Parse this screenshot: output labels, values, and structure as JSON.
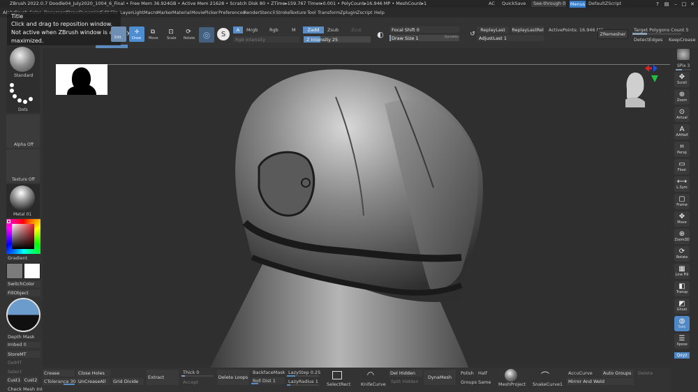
{
  "titlebar": {
    "title": "ZBrush 2022.0.7   Doodle04_July2020_1004_6_Final  • Free Mem 36.924GB • Active Mem 21628 • Scratch Disk 80 • ZTime▸159.767 Timer▸0.001 • PolyCount▸16.946 MP • MeshCount▸1",
    "ac": "AC",
    "quicksave": "QuickSave",
    "see_through": "See-through  0",
    "menus": "Menus",
    "script": "DefaultZScript"
  },
  "menubar": [
    "Alpha",
    "Brush",
    "Color",
    "Document",
    "Draw",
    "Dynamics",
    "Edit",
    "File",
    "Layer",
    "Light",
    "Macro",
    "Marker",
    "Material",
    "Movie",
    "Picker",
    "Preferences",
    "Render",
    "Stencil",
    "Stroke",
    "Texture",
    "Tool",
    "Transform",
    "Zplugin",
    "Zscript",
    "Help"
  ],
  "tooltip": {
    "title": "Title",
    "line1": "Click and drag to reposition window.",
    "line2": "Not active when ZBrush window is already",
    "line3": "maximized."
  },
  "toolbar": {
    "edit": "Edit",
    "draw": "Draw",
    "move": "Move",
    "scale": "Scale",
    "rotate": "Rotate",
    "a": "A",
    "mrgb": "Mrgb",
    "rgb": "Rgb",
    "m": "M",
    "zadd": "Zadd",
    "zsub": "Zsub",
    "zcut": "Zcut",
    "rgb_intensity": "Rgb Intensity",
    "z_intensity": "Z Intensity 25",
    "focal_shift": "Focal Shift 0",
    "draw_size": "Draw Size 1",
    "dynamic": "Dynamic",
    "replay_last": "ReplayLast",
    "replay_last_rel": "ReplayLastRel",
    "adjust_last": "AdjustLast 1",
    "active_points": "ActivePoints: 16.946 Mil",
    "zremesher": "ZRemesher",
    "target_polygons": "Target Polygons Count 5",
    "detect_edges": "DetectEdges",
    "keep_creases": "KeepCrease"
  },
  "left": {
    "standard": "Standard",
    "dots": "Dots",
    "alpha_off": "Alpha Off",
    "texture_off": "Texture Off",
    "metal": "Metal 01",
    "gradient": "Gradient",
    "switch_color": "SwitchColor",
    "fill_object": "FillObject",
    "depth_mask": "Depth Mask",
    "imbed": "Imbed 0",
    "store_mt": "StoreMT",
    "del_mt": "DelMT",
    "select": "Select",
    "cust1": "Cust1",
    "cust2": "Cust2",
    "check_mesh": "Check Mesh Int",
    "main_color": "#c81a25",
    "secondary_color": "#ffffff",
    "primary_swatch": "#7b7b7b"
  },
  "right": {
    "spix": "SPix 3",
    "items": [
      "Scroll",
      "Zoom",
      "Actual",
      "AAHalf",
      "Persp",
      "Floor",
      "L.Sym",
      "Frame",
      "Move",
      "Zoom3D",
      "Rotate",
      "Line Fill",
      "Transp",
      "Ghost",
      "Solo",
      "Xpose"
    ],
    "xyz": "Qxyz"
  },
  "bottom": {
    "crease": "Crease",
    "ctolerance": "CTolerance 30",
    "close_holes": "Close Holes",
    "uncrease_all": "UnCreaseAll",
    "grid_divide": "Grid Divide",
    "extract": "Extract",
    "thick": "Thick 0",
    "accept": "Accept",
    "delete_loops": "Delete Loops",
    "backface_mask": "BackfaceMask",
    "roll_dist": "Roll Dist 1",
    "lazystep": "LazyStep 0.25",
    "lazyradius": "LazyRadius 1",
    "select_rect": "SelectRect",
    "knife_curve": "KnifeCurve",
    "del_hidden": "Del Hidden",
    "split_hidden": "Split Hidden",
    "dynamesh": "DynaMesh",
    "polish": "Polish",
    "groups": "Groups",
    "half": "Half",
    "same": "Same",
    "mesh_project": "MeshProject",
    "snake_curve": "SnakeCurve1",
    "accu_curve": "AccuCurve",
    "auto_groups": "Auto Groups",
    "delete": "Delete",
    "mirror_weld": "Mirror And Weld"
  }
}
